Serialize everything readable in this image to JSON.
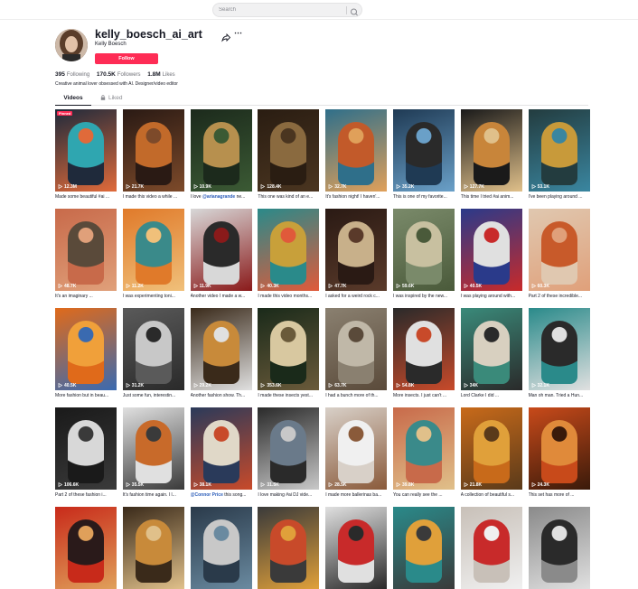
{
  "search": {
    "placeholder": "Search"
  },
  "profile": {
    "username": "kelly_boesch_ai_art",
    "display_name": "Kelly Boesch",
    "follow_label": "Follow",
    "following_count": "395",
    "following_label": "Following",
    "followers_count": "170.5K",
    "followers_label": "Followers",
    "likes_count": "1.8M",
    "likes_label": "Likes",
    "bio": "Creative animal lover obsessed with AI. Designer/video editor"
  },
  "tabs": {
    "videos": "Videos",
    "liked": "Liked"
  },
  "pinned_label": "Pinned",
  "videos": [
    {
      "views": "12.3M",
      "caption": "Made some beautiful #ai ...",
      "bg": "#1f2a3b",
      "fig": "#2fa6b0",
      "acc": "#e06a3a"
    },
    {
      "views": "21.7K",
      "caption": "I made this video a while ...",
      "bg": "#2a1a14",
      "fig": "#c26a2a",
      "acc": "#7d4a2a"
    },
    {
      "views": "10.9K",
      "caption": "I love @arianagrande ne...",
      "hl": "@arianagrande",
      "bg": "#1c2a1c",
      "fig": "#b7904e",
      "acc": "#3b5a34"
    },
    {
      "views": "128.4K",
      "caption": "This one was kind of an e...",
      "bg": "#2a1d12",
      "fig": "#8a6a3f",
      "acc": "#4a3520"
    },
    {
      "views": "32.7K",
      "caption": "It's fashion night! I haven'...",
      "bg": "#2f6f8a",
      "fig": "#c25a2a",
      "acc": "#e0a05a"
    },
    {
      "views": "35.2K",
      "caption": "This is one of my favorite...",
      "bg": "#1f3a54",
      "fig": "#2a2a2a",
      "acc": "#6aa0c8"
    },
    {
      "views": "127.7K",
      "caption": "This time I tried #ai anim...",
      "bg": "#1a1a1a",
      "fig": "#c8853a",
      "acc": "#e0c08a"
    },
    {
      "views": "53.1K",
      "caption": "I've been playing around ...",
      "bg": "#233c3f",
      "fig": "#c89a3a",
      "acc": "#3a86a0"
    },
    {
      "views": "48.7K",
      "caption": "It's an imaginary ...",
      "bg": "#c86a4a",
      "fig": "#5a4a3a",
      "acc": "#e0a07a"
    },
    {
      "views": "11.2K",
      "caption": "I was experimenting toni...",
      "bg": "#e07a2a",
      "fig": "#3a8a8a",
      "acc": "#f0c07a"
    },
    {
      "views": "11.9K",
      "caption": "Another video I made a w...",
      "bg": "#d8d8d8",
      "fig": "#2a2a2a",
      "acc": "#8a1a1a"
    },
    {
      "views": "40.3K",
      "caption": "I made this video months...",
      "bg": "#2a8a8a",
      "fig": "#c8a03a",
      "acc": "#e05a3a"
    },
    {
      "views": "47.7K",
      "caption": "I asked for a weird rock c...",
      "bg": "#2a1a14",
      "fig": "#c8b08a",
      "acc": "#5a3a2a"
    },
    {
      "views": "59.6K",
      "caption": "I was inspired by the new...",
      "bg": "#7a8a6a",
      "fig": "#c8c0a0",
      "acc": "#4a5a3a"
    },
    {
      "views": "40.5K",
      "caption": "I was playing around with...",
      "bg": "#2a3a8a",
      "fig": "#e0e0e0",
      "acc": "#c82a2a"
    },
    {
      "views": "60.3K",
      "caption": "Part 2 of these incredible...",
      "bg": "#e0c8b0",
      "fig": "#c85a2a",
      "acc": "#e0a07a"
    },
    {
      "views": "40.5K",
      "caption": "More fashion but in beau...",
      "bg": "#e06a1a",
      "fig": "#f0a03a",
      "acc": "#3a6ab0"
    },
    {
      "views": "31.2K",
      "caption": "Just some fun, interestin...",
      "bg": "#5a5a5a",
      "fig": "#c8c8c8",
      "acc": "#2a2a2a"
    },
    {
      "views": "29.2K",
      "caption": "Another fashion show. Th...",
      "bg": "#3a2a1a",
      "fig": "#c88a3a",
      "acc": "#e0e0e0"
    },
    {
      "views": "353.6K",
      "caption": "I made these insects yest...",
      "bg": "#1a2a1a",
      "fig": "#d8c8a0",
      "acc": "#6a5a3a"
    },
    {
      "views": "63.7K",
      "caption": "I had a bunch more of th...",
      "bg": "#8a8070",
      "fig": "#c0b8a8",
      "acc": "#5a4a3a"
    },
    {
      "views": "54.8K",
      "caption": "More insects. I just can't ...",
      "bg": "#2a2a2a",
      "fig": "#e0e0e0",
      "acc": "#c84a2a"
    },
    {
      "views": "34K",
      "caption": "Lord Clarke I did ...",
      "bg": "#3a8a7a",
      "fig": "#d8d0c0",
      "acc": "#2a2a2a"
    },
    {
      "views": "32.1K",
      "caption": "Man oh man. Tried a Hun...",
      "bg": "#2a8a8a",
      "fig": "#2a2a2a",
      "acc": "#e0e0e0"
    },
    {
      "views": "106.6K",
      "caption": "Part 2 of these fashion i...",
      "bg": "#1a1a1a",
      "fig": "#d8d8d8",
      "acc": "#3a3a3a"
    },
    {
      "views": "35.5K",
      "caption": "It's fashion time again. I l...",
      "bg": "#e0e0e0",
      "fig": "#c86a2a",
      "acc": "#3a3a3a"
    },
    {
      "views": "38.1K",
      "caption": "@Connor Price this song...",
      "hl": "@Connor Price",
      "bg": "#2a3a5a",
      "fig": "#e0d8c8",
      "acc": "#c84a2a"
    },
    {
      "views": "31.5K",
      "caption": "I love making #ai DJ vide...",
      "bg": "#2a2a2a",
      "fig": "#6a7a8a",
      "acc": "#c8c8c8"
    },
    {
      "views": "28.5K",
      "caption": "I made more ballerinas ba...",
      "bg": "#d8d0c8",
      "fig": "#f0f0f0",
      "acc": "#8a5a3a"
    },
    {
      "views": "39.8K",
      "caption": "You can really see the ...",
      "bg": "#c86a4a",
      "fig": "#3a8a8a",
      "acc": "#e0c08a"
    },
    {
      "views": "21.8K",
      "caption": "A collection of beautiful s...",
      "bg": "#c86a1a",
      "fig": "#e0a03a",
      "acc": "#5a3a1a"
    },
    {
      "views": "24.3K",
      "caption": "This set has more of ...",
      "bg": "#c84a1a",
      "fig": "#e08a3a",
      "acc": "#3a1a0a"
    },
    {
      "views": "",
      "caption": "",
      "bg": "#c82a1a",
      "fig": "#2a1a1a",
      "acc": "#e0a05a"
    },
    {
      "views": "",
      "caption": "",
      "bg": "#3a2a1a",
      "fig": "#c88a3a",
      "acc": "#e0c08a"
    },
    {
      "views": "",
      "caption": "",
      "bg": "#2a3a4a",
      "fig": "#c8c8c8",
      "acc": "#6a8aa0"
    },
    {
      "views": "",
      "caption": "",
      "bg": "#3a3a3a",
      "fig": "#c84a2a",
      "acc": "#e0a03a"
    },
    {
      "views": "",
      "caption": "",
      "bg": "#e0e0e0",
      "fig": "#c82a2a",
      "acc": "#2a2a2a"
    },
    {
      "views": "",
      "caption": "",
      "bg": "#2a8a8a",
      "fig": "#e0a03a",
      "acc": "#3a3a3a"
    },
    {
      "views": "",
      "caption": "",
      "bg": "#c8c0b8",
      "fig": "#c82a2a",
      "acc": "#f0f0f0"
    },
    {
      "views": "",
      "caption": "",
      "bg": "#8a8a8a",
      "fig": "#2a2a2a",
      "acc": "#e0e0e0"
    }
  ]
}
